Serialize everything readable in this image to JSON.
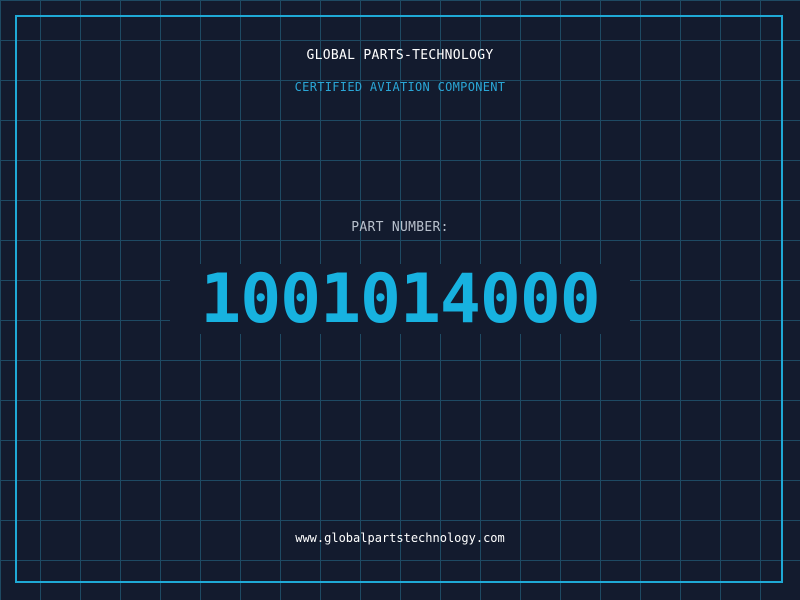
{
  "header": {
    "title": "GLOBAL PARTS-TECHNOLOGY",
    "subtitle": "CERTIFIED AVIATION COMPONENT"
  },
  "part": {
    "label": "PART NUMBER:",
    "number": "1001014000"
  },
  "footer": {
    "website": "www.globalpartstechnology.com"
  },
  "colors": {
    "background": "#131b2e",
    "grid": "#1e4a63",
    "accent": "#17b2e0",
    "border": "#1fa9d6"
  }
}
